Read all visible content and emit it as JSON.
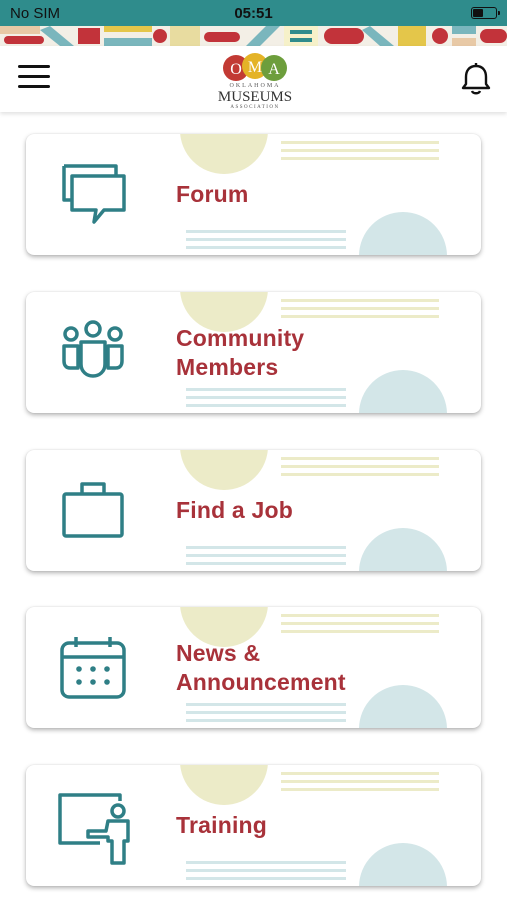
{
  "status_bar": {
    "carrier": "No SIM",
    "time": "05:51"
  },
  "header": {
    "logo": {
      "letters": [
        "O",
        "M",
        "A"
      ],
      "subtitle": "OKLAHOMA",
      "name": "MUSEUMS",
      "tagline": "ASSOCIATION"
    }
  },
  "menu": [
    {
      "label": "Forum",
      "icon": "chat-bubbles-icon"
    },
    {
      "label": "Community Members",
      "icon": "people-group-icon"
    },
    {
      "label": "Find a Job",
      "icon": "briefcase-icon"
    },
    {
      "label": "News & Announcement",
      "icon": "calendar-icon"
    },
    {
      "label": "Training",
      "icon": "presenter-whiteboard-icon"
    }
  ],
  "colors": {
    "status_bar": "#2f8c8c",
    "label": "#a8323a",
    "icon": "#2f7f86",
    "deco_yellow": "#ecebc8",
    "deco_blue": "#d3e6e8",
    "logo_red": "#c23a34",
    "logo_yellow": "#e4b327",
    "logo_green": "#6d9e3c"
  }
}
